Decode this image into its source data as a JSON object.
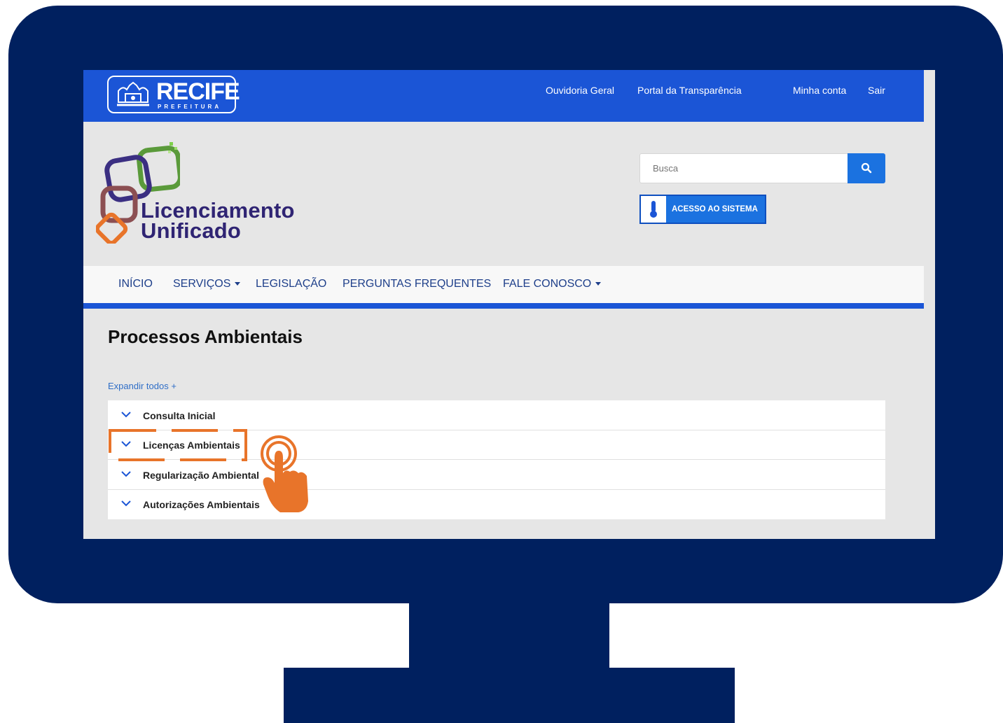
{
  "header": {
    "logo_text": "RECIFE",
    "logo_subtext": "PREFEITURA",
    "links": [
      "Ouvidoria Geral",
      "Portal da Transparência",
      "Minha conta",
      "Sair"
    ]
  },
  "brand": {
    "line1": "Licenciamento",
    "line2": "Unificado"
  },
  "search": {
    "placeholder": "Busca",
    "button_icon": "search-icon"
  },
  "access": {
    "label": "ACESSO AO SISTEMA",
    "icon": "thermometer-icon"
  },
  "nav": {
    "items": [
      "INÍCIO",
      "SERVIÇOS",
      "LEGISLAÇÃO",
      "PERGUNTAS FREQUENTES",
      "FALE CONOSCO"
    ]
  },
  "main": {
    "title": "Processos Ambientais",
    "expand_all": "Expandir todos +",
    "accordion": [
      "Consulta Inicial",
      "Licenças Ambientais",
      "Regularização Ambiental",
      "Autorizações Ambientais"
    ]
  },
  "colors": {
    "monitor": "#00205f",
    "header_blue": "#1b55d6",
    "button_blue": "#1b72e0",
    "highlight_orange": "#e8742a",
    "brand_purple": "#2f2473"
  }
}
